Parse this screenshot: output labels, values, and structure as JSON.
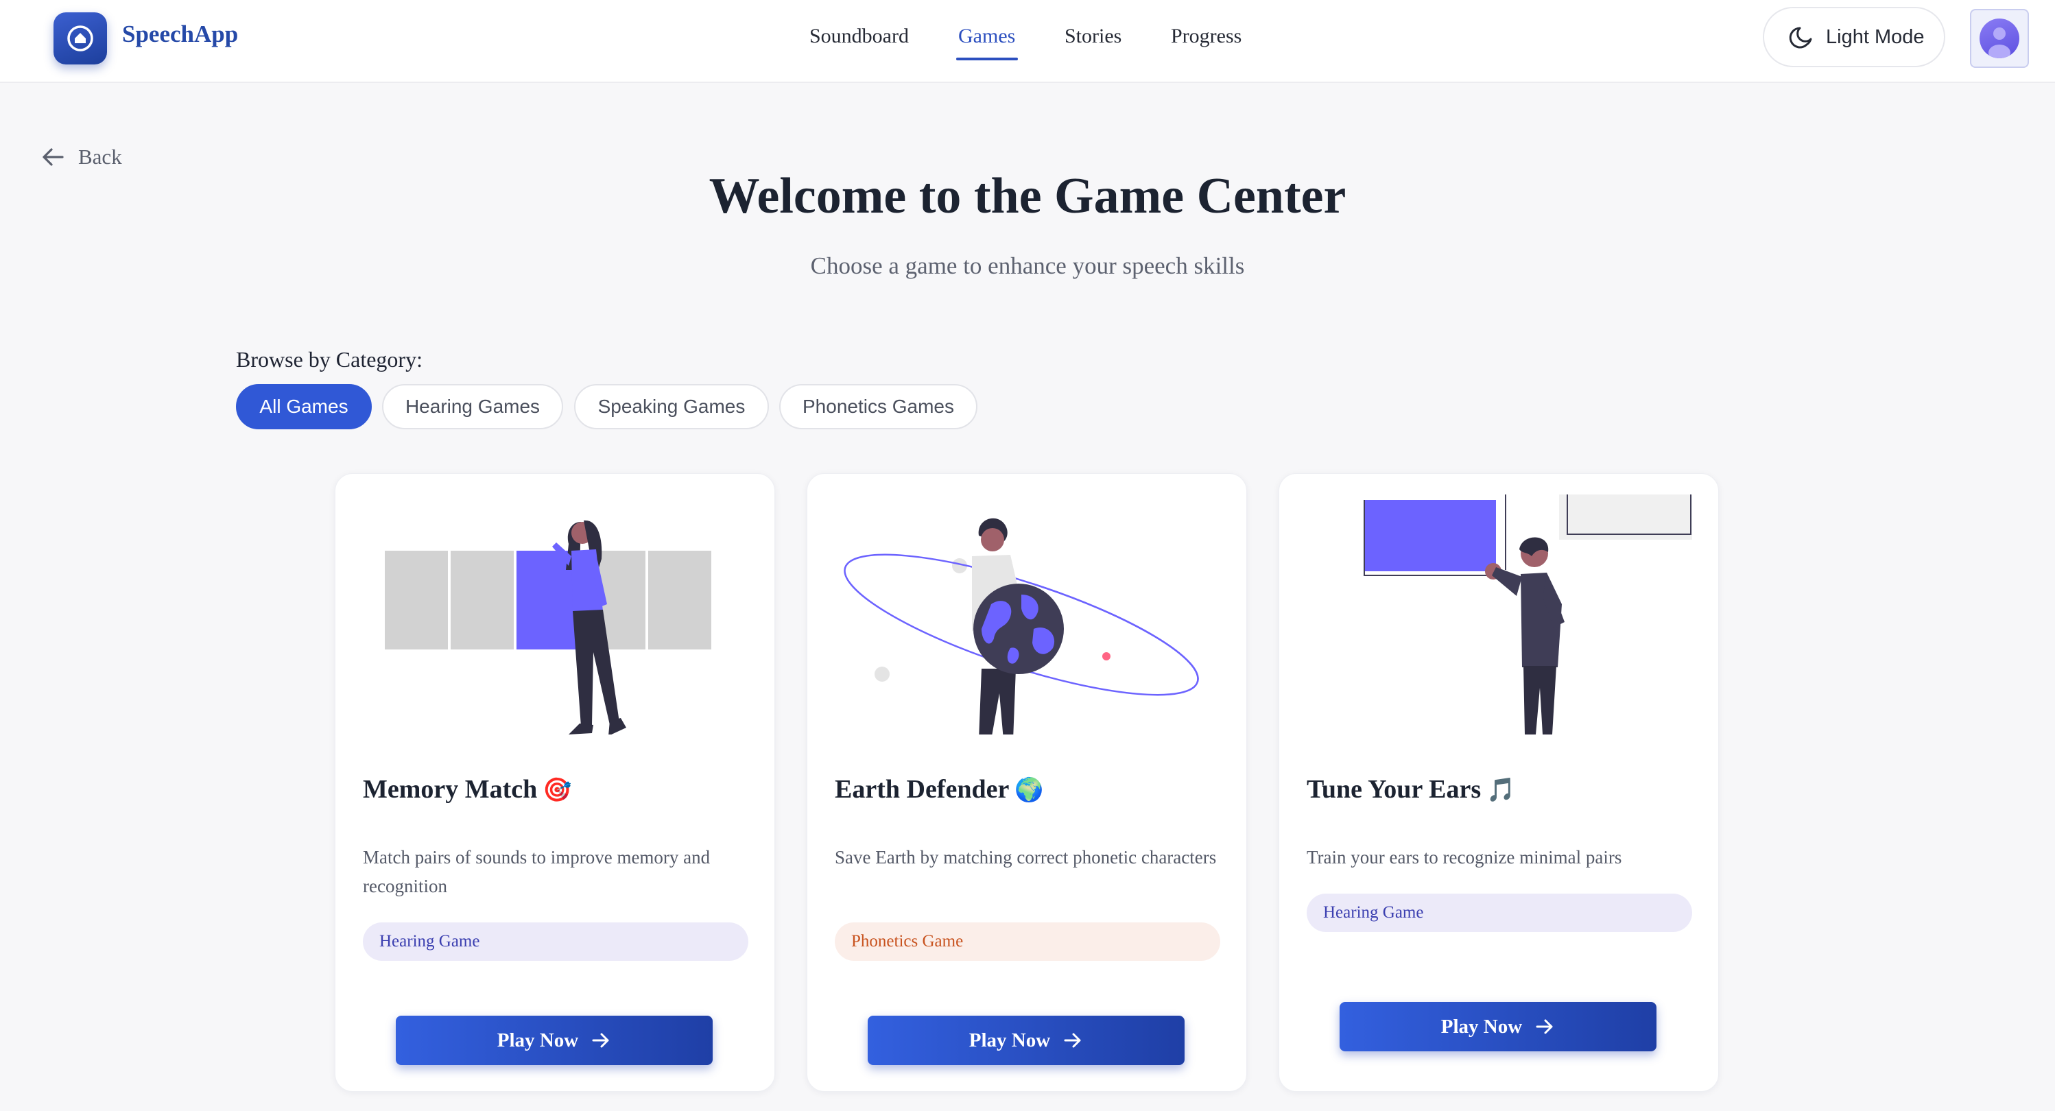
{
  "app": {
    "name": "SpeechApp"
  },
  "nav": {
    "links": [
      {
        "label": "Soundboard",
        "active": false
      },
      {
        "label": "Games",
        "active": true
      },
      {
        "label": "Stories",
        "active": false
      },
      {
        "label": "Progress",
        "active": false
      }
    ],
    "mode_toggle": {
      "label": "Light Mode",
      "icon": "moon-icon"
    },
    "avatar_icon": "user-icon"
  },
  "page": {
    "back_label": "Back",
    "title": "Welcome to the Game Center",
    "subtitle": "Choose a game to enhance your speech skills",
    "browse_label": "Browse by Category:"
  },
  "categories": [
    {
      "label": "All Games",
      "active": true
    },
    {
      "label": "Hearing Games",
      "active": false
    },
    {
      "label": "Speaking Games",
      "active": false
    },
    {
      "label": "Phonetics Games",
      "active": false
    }
  ],
  "games": [
    {
      "title": "Memory Match",
      "emoji": "🎯",
      "description": "Match pairs of sounds to improve memory and recognition",
      "tag": "Hearing Game",
      "button": "Play Now"
    },
    {
      "title": "Earth Defender",
      "emoji": "🌍",
      "description": "Save Earth by matching correct phonetic characters",
      "tag": "Phonetics Game",
      "button": "Play Now"
    },
    {
      "title": "Tune Your Ears",
      "emoji": "🎵",
      "description": "Train your ears to recognize minimal pairs",
      "tag": "Hearing Game",
      "button": "Play Now"
    }
  ],
  "colors": {
    "accent": "#3058d6",
    "brand": "#2549a8",
    "illustration_purple": "#6c63ff",
    "hearing_tag_bg": "#eceaf9",
    "phonetics_tag_bg": "#fbeee9"
  }
}
